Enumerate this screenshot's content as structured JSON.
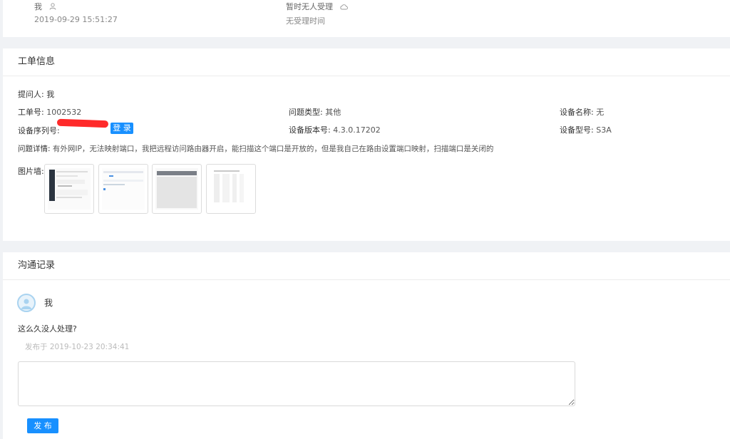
{
  "top": {
    "submitter": "我",
    "submit_time": "2019-09-29 15:51:27",
    "handler_status": "暂时无人受理",
    "handle_time": "无受理时间"
  },
  "ticket": {
    "header": "工单信息",
    "asker_label": "提问人:",
    "asker_value": "我",
    "ticket_no_label": "工单号:",
    "ticket_no_value": "1002532",
    "problem_type_label": "问题类型:",
    "problem_type_value": "其他",
    "device_name_label": "设备名称:",
    "device_name_value": "无",
    "serial_label": "设备序列号:",
    "login_button": "登 录",
    "firmware_label": "设备版本号:",
    "firmware_value": "4.3.0.17202",
    "model_label": "设备型号:",
    "model_value": "S3A",
    "detail_label": "问题详情:",
    "detail_value": "有外网IP，无法映射端口，我把远程访问路由器开启，能扫描这个端口是开放的，但是我自己在路由设置端口映射，扫描端口是关闭的",
    "gallery_label": "图片墙:"
  },
  "communication": {
    "header": "沟通记录",
    "message_author": "我",
    "message_text": "这么久没人处理?",
    "message_time": "发布于 2019-10-23 20:34:41",
    "reply_placeholder": "",
    "publish_button": "发 布"
  },
  "colors": {
    "accent": "#1890ff",
    "redaction": "#ff2a2a",
    "background": "#f0f2f5"
  }
}
